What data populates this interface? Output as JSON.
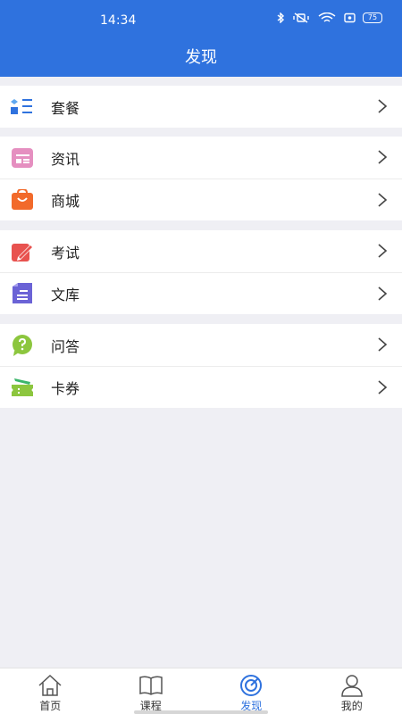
{
  "status": {
    "time": "14:34",
    "battery": "75"
  },
  "header": {
    "title": "发现"
  },
  "groups": [
    {
      "items": [
        {
          "label": "套餐",
          "icon": "package-list-icon"
        }
      ]
    },
    {
      "items": [
        {
          "label": "资讯",
          "icon": "news-icon"
        },
        {
          "label": "商城",
          "icon": "shop-bag-icon"
        }
      ]
    },
    {
      "items": [
        {
          "label": "考试",
          "icon": "exam-pen-icon"
        },
        {
          "label": "文库",
          "icon": "library-doc-icon"
        }
      ]
    },
    {
      "items": [
        {
          "label": "问答",
          "icon": "qa-bubble-icon"
        },
        {
          "label": "卡券",
          "icon": "coupon-ticket-icon"
        }
      ]
    }
  ],
  "tabbar": {
    "tabs": [
      {
        "label": "首页",
        "icon": "home-icon",
        "active": false
      },
      {
        "label": "课程",
        "icon": "book-icon",
        "active": false
      },
      {
        "label": "发现",
        "icon": "discover-compass-icon",
        "active": true
      },
      {
        "label": "我的",
        "icon": "user-icon",
        "active": false
      }
    ]
  },
  "colors": {
    "primary": "#2f72de",
    "background": "#efeff4"
  }
}
